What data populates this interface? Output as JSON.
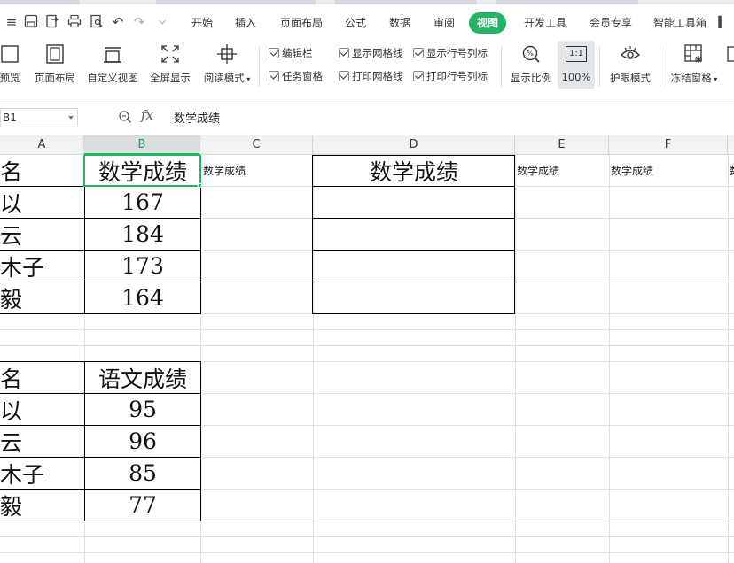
{
  "tabbar": {
    "tabs": [
      {
        "label": "开始",
        "active": false
      },
      {
        "label": "插入",
        "active": false
      },
      {
        "label": "页面布局",
        "active": false
      },
      {
        "label": "公式",
        "active": false
      },
      {
        "label": "数据",
        "active": false
      },
      {
        "label": "审阅",
        "active": false
      },
      {
        "label": "视图",
        "active": true
      },
      {
        "label": "开发工具",
        "active": false
      },
      {
        "label": "会员专享",
        "active": false
      },
      {
        "label": "智能工具箱",
        "active": false
      }
    ]
  },
  "ribbon": {
    "preview_label": "预览",
    "page_layout_label": "页面布局",
    "custom_view_label": "自定义视图",
    "fullscreen_label": "全屏显示",
    "reading_mode_label": "阅读模式",
    "checkboxes": {
      "edit_bar": "编辑栏",
      "task_pane": "任务窗格",
      "show_gridlines": "显示网格线",
      "print_gridlines": "打印网格线",
      "show_headers": "显示行号列标",
      "print_headers": "打印行号列标"
    },
    "zoom_label": "显示比例",
    "zoom100_label": "100%",
    "zoom100_icon_text": "1:1",
    "eye_mode_label": "护眼模式",
    "freeze_label": "冻结窗格"
  },
  "formula_bar": {
    "cell_ref": "B1",
    "fx_label": "fx",
    "content": "数学成绩"
  },
  "columns": [
    "A",
    "B",
    "C",
    "D",
    "E",
    "F"
  ],
  "sheet": {
    "header_row": {
      "a": "名",
      "b": "数学成绩",
      "c": "数学成绩",
      "d": "数学成绩",
      "e": "数学成绩",
      "f": "数学成绩",
      "g": "数"
    },
    "math_rows": [
      {
        "name": "以",
        "score": "167"
      },
      {
        "name": "云",
        "score": "184"
      },
      {
        "name": "木子",
        "score": "173"
      },
      {
        "name": "毅",
        "score": "164"
      }
    ],
    "chinese_header": {
      "a": "名",
      "b": "语文成绩"
    },
    "chinese_rows": [
      {
        "name": "以",
        "score": "95"
      },
      {
        "name": "云",
        "score": "96"
      },
      {
        "name": "木子",
        "score": "85"
      },
      {
        "name": "毅",
        "score": "77"
      }
    ]
  },
  "colors": {
    "accent": "#25b466",
    "active_tab_text": "#ffffff"
  }
}
